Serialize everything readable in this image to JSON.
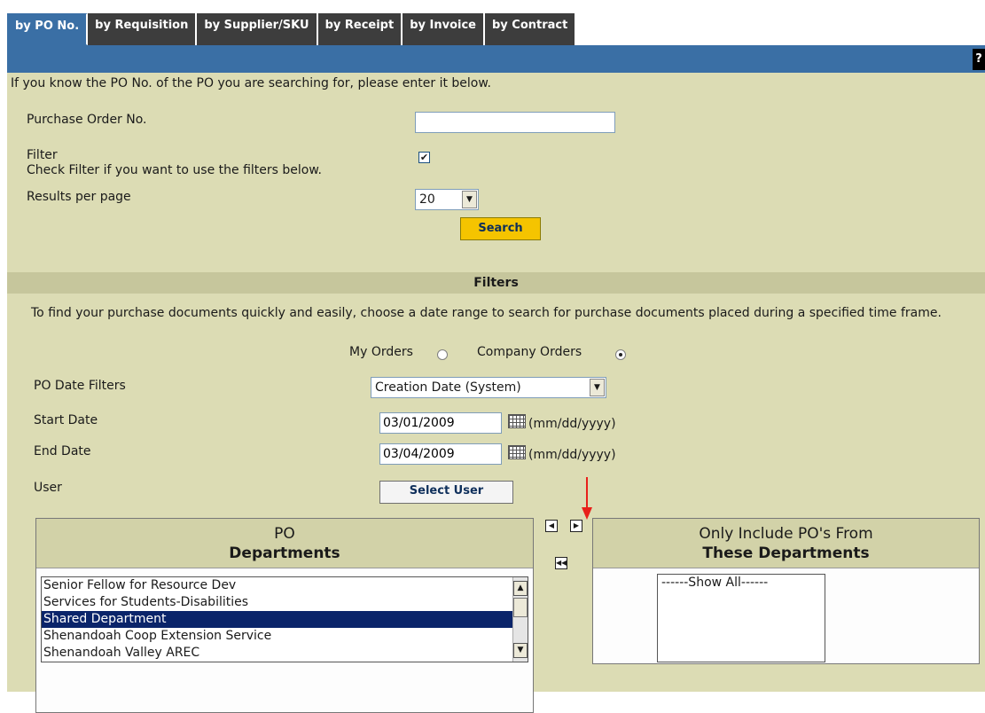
{
  "tabs": [
    {
      "label": "by PO No.",
      "active": true
    },
    {
      "label": "by Requisition"
    },
    {
      "label": "by Supplier/SKU"
    },
    {
      "label": "by Receipt"
    },
    {
      "label": "by Invoice"
    },
    {
      "label": "by Contract"
    }
  ],
  "help_label": "?",
  "intro": "If you know the PO No. of the PO you are searching for, please enter it below.",
  "po_number": {
    "label": "Purchase Order No.",
    "value": ""
  },
  "filter": {
    "label": "Filter",
    "hint": "Check Filter if you want to use the filters below.",
    "checked": true,
    "mark": "✔"
  },
  "results_per_page": {
    "label": "Results per page",
    "value": "20"
  },
  "search_button": "Search",
  "filters_section": {
    "title": "Filters",
    "description": "To find your purchase documents quickly and easily, choose a date range to search for purchase documents placed during a specified time frame.",
    "my_orders_label": "My Orders",
    "company_orders_label": "Company Orders",
    "selected_scope": "Company Orders",
    "po_date_filters": {
      "label": "PO Date Filters",
      "value": "Creation Date (System)"
    },
    "start_date": {
      "label": "Start Date",
      "value": "03/01/2009",
      "format": "(mm/dd/yyyy)"
    },
    "end_date": {
      "label": "End Date",
      "value": "03/04/2009",
      "format": "(mm/dd/yyyy)"
    },
    "user": {
      "label": "User",
      "button": "Select User"
    }
  },
  "departments": {
    "left_title_line1": "PO",
    "left_title_line2": "Departments",
    "items": [
      "Senior Fellow for Resource Dev",
      "Services for Students-Disabilities",
      "Shared Department",
      "Shenandoah Coop Extension Service",
      "Shenandoah Valley AREC"
    ],
    "selected": "Shared Department",
    "right_title_line1": "Only Include PO's From",
    "right_title_line2": "These Departments",
    "right_items": [
      "------Show All------"
    ]
  },
  "colors": {
    "tab_bar": "#3a6fa5",
    "panel": "#dcdcb4",
    "search_button": "#f5c400",
    "annotation_arrow": "#e8201a"
  },
  "icons": [
    "calendar-icon",
    "move-left-icon",
    "move-right-icon",
    "move-all-left-icon",
    "scroll-up-icon",
    "scroll-down-icon",
    "dropdown-arrow-icon"
  ]
}
